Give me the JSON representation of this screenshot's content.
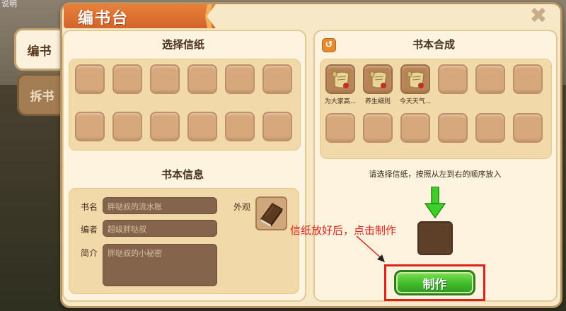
{
  "corner_text": "说明",
  "window": {
    "title": "编书台",
    "close_icon": "close-x-icon"
  },
  "tabs": [
    {
      "label": "编书",
      "active": true
    },
    {
      "label": "拆书",
      "active": false
    }
  ],
  "left_panel": {
    "paper_section_title": "选择信纸",
    "paper_slots_count": 12,
    "book_info_title": "书本信息",
    "fields": {
      "name_label": "书名",
      "name_value": "胖哒叔的流水账",
      "author_label": "编者",
      "author_value": "超级胖哒叔",
      "intro_label": "简介",
      "intro_value": "胖哒叔的小秘密",
      "appearance_label": "外观"
    }
  },
  "right_panel": {
    "title": "书本合成",
    "refresh_icon": "refresh-icon",
    "slots": [
      {
        "filled": true,
        "caption": "为大家高..."
      },
      {
        "filled": true,
        "caption": "养生细则"
      },
      {
        "filled": true,
        "caption": "今天天气..."
      },
      {
        "filled": false,
        "caption": ""
      },
      {
        "filled": false,
        "caption": ""
      },
      {
        "filled": false,
        "caption": ""
      },
      {
        "filled": false,
        "caption": ""
      },
      {
        "filled": false,
        "caption": ""
      },
      {
        "filled": false,
        "caption": ""
      },
      {
        "filled": false,
        "caption": ""
      },
      {
        "filled": false,
        "caption": ""
      },
      {
        "filled": false,
        "caption": ""
      }
    ],
    "instruction": "请选择信纸，按照从左到右的顺序放入",
    "make_button_label": "制作"
  },
  "annotation": {
    "text": "信纸放好后，点击制作",
    "color": "#e0201a"
  },
  "colors": {
    "panel_bg": "#fdf3df",
    "slot": "#d6a87b",
    "make_button": "#3fbb2b",
    "title_banner": "#e9803a"
  }
}
